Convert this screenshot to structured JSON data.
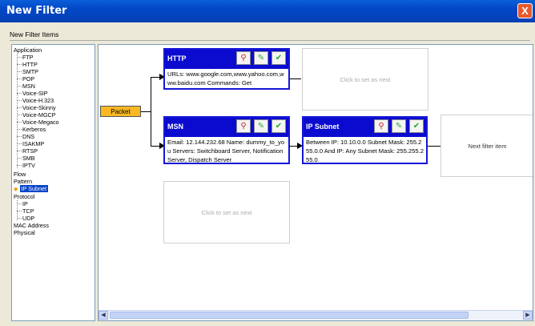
{
  "window": {
    "title": "New Filter",
    "close_glyph": "X"
  },
  "section": {
    "label": "New Filter Items"
  },
  "tree": {
    "application": "Application",
    "apps": [
      "FTP",
      "HTTP",
      "SMTP",
      "POP",
      "MSN",
      "Voice-SIP",
      "Voice-H.323",
      "Voice-Skinny",
      "Voice-MGCP",
      "Voice-Megaco",
      "Kerberos",
      "DNS",
      "ISAKMP",
      "RTSP",
      "SMB",
      "IPTV"
    ],
    "flow": "Flow",
    "pattern": "Pattern",
    "pattern_selected": "IP Subnet",
    "protocol": "Protocol",
    "protocols": [
      "IP",
      "TCP",
      "UDP"
    ],
    "mac": "MAC Address",
    "physical": "Physical"
  },
  "canvas": {
    "packet": "Packet",
    "boxes": [
      {
        "title": "HTTP",
        "body": "URLs: www.google.com,www.yahoo.com,www.baidu.com Commands: Get"
      },
      {
        "title": "MSN",
        "body": "Email: 12.144.232.68 Name: dummy_to_you Servers: Switchboard Server, Notification Server, Dispatch Server"
      },
      {
        "title": "IP Subnet",
        "body": "Between IP: 10.10.0.0 Subnet Mask: 255.255.0.0 And IP: Any Subnet Mask: 255.255.255.0"
      }
    ],
    "empty_slot": "Click to set as next",
    "next_item": "Next filter item"
  },
  "icons": {
    "filter": "filter-icon",
    "edit": "edit-icon",
    "apply": "apply-icon"
  },
  "colors": {
    "title_bar": "#0347c6",
    "box_header": "#0b0bd0",
    "packet": "#f9b722",
    "selection": "#0a46c8"
  }
}
